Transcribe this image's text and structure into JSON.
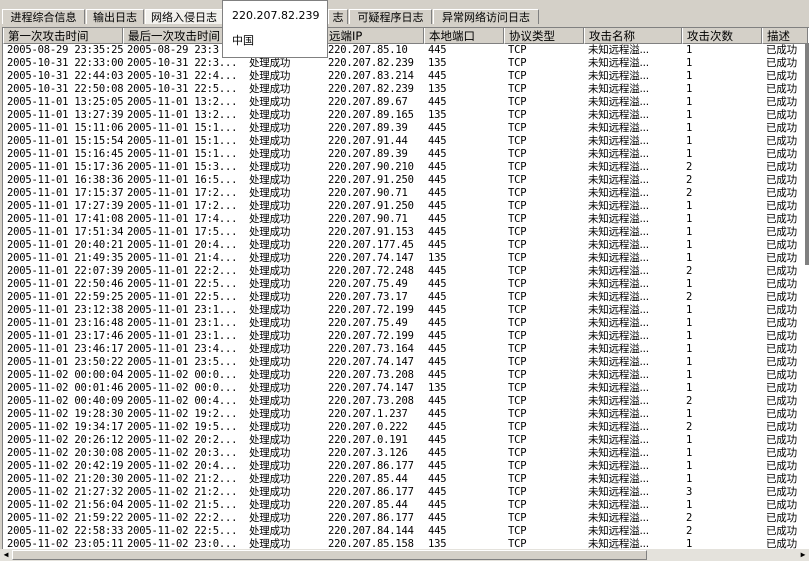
{
  "tabs": [
    {
      "label": "进程综合信息",
      "active": false
    },
    {
      "label": "输出日志",
      "active": false
    },
    {
      "label": "网络入侵日志",
      "active": true
    },
    {
      "label": "志",
      "active": false
    },
    {
      "label": "可疑程序日志",
      "active": false
    },
    {
      "label": "异常网络访问日志",
      "active": false
    }
  ],
  "tooltip": {
    "ip": "220.207.82.239",
    "country": "中国"
  },
  "columns": [
    "第一次攻击时间",
    "最后一次攻击时间",
    "",
    "远端IP",
    "本地端口",
    "协议类型",
    "攻击名称",
    "攻击次数",
    "描述"
  ],
  "rows": [
    [
      "2005-08-29 23:35:25",
      "2005-08-29 23:3",
      "",
      "220.207.85.10",
      "445",
      "TCP",
      "未知远程溢...",
      "1",
      "已成功"
    ],
    [
      "2005-10-31 22:33:00",
      "2005-10-31 22:3...",
      "处理成功",
      "220.207.82.239",
      "135",
      "TCP",
      "未知远程溢...",
      "1",
      "已成功"
    ],
    [
      "2005-10-31 22:44:03",
      "2005-10-31 22:4...",
      "处理成功",
      "220.207.83.214",
      "445",
      "TCP",
      "未知远程溢...",
      "1",
      "已成功"
    ],
    [
      "2005-10-31 22:50:08",
      "2005-10-31 22:5...",
      "处理成功",
      "220.207.82.239",
      "135",
      "TCP",
      "未知远程溢...",
      "1",
      "已成功"
    ],
    [
      "2005-11-01 13:25:05",
      "2005-11-01 13:2...",
      "处理成功",
      "220.207.89.67",
      "445",
      "TCP",
      "未知远程溢...",
      "1",
      "已成功"
    ],
    [
      "2005-11-01 13:27:39",
      "2005-11-01 13:2...",
      "处理成功",
      "220.207.89.165",
      "135",
      "TCP",
      "未知远程溢...",
      "1",
      "已成功"
    ],
    [
      "2005-11-01 15:11:06",
      "2005-11-01 15:1...",
      "处理成功",
      "220.207.89.39",
      "445",
      "TCP",
      "未知远程溢...",
      "1",
      "已成功"
    ],
    [
      "2005-11-01 15:15:54",
      "2005-11-01 15:1...",
      "处理成功",
      "220.207.91.44",
      "445",
      "TCP",
      "未知远程溢...",
      "1",
      "已成功"
    ],
    [
      "2005-11-01 15:16:45",
      "2005-11-01 15:1...",
      "处理成功",
      "220.207.89.39",
      "445",
      "TCP",
      "未知远程溢...",
      "1",
      "已成功"
    ],
    [
      "2005-11-01 15:17:36",
      "2005-11-01 15:3...",
      "处理成功",
      "220.207.90.210",
      "445",
      "TCP",
      "未知远程溢...",
      "2",
      "已成功"
    ],
    [
      "2005-11-01 16:38:36",
      "2005-11-01 16:5...",
      "处理成功",
      "220.207.91.250",
      "445",
      "TCP",
      "未知远程溢...",
      "2",
      "已成功"
    ],
    [
      "2005-11-01 17:15:37",
      "2005-11-01 17:2...",
      "处理成功",
      "220.207.90.71",
      "445",
      "TCP",
      "未知远程溢...",
      "2",
      "已成功"
    ],
    [
      "2005-11-01 17:27:39",
      "2005-11-01 17:2...",
      "处理成功",
      "220.207.91.250",
      "445",
      "TCP",
      "未知远程溢...",
      "1",
      "已成功"
    ],
    [
      "2005-11-01 17:41:08",
      "2005-11-01 17:4...",
      "处理成功",
      "220.207.90.71",
      "445",
      "TCP",
      "未知远程溢...",
      "1",
      "已成功"
    ],
    [
      "2005-11-01 17:51:34",
      "2005-11-01 17:5...",
      "处理成功",
      "220.207.91.153",
      "445",
      "TCP",
      "未知远程溢...",
      "1",
      "已成功"
    ],
    [
      "2005-11-01 20:40:21",
      "2005-11-01 20:4...",
      "处理成功",
      "220.207.177.45",
      "445",
      "TCP",
      "未知远程溢...",
      "1",
      "已成功"
    ],
    [
      "2005-11-01 21:49:35",
      "2005-11-01 21:4...",
      "处理成功",
      "220.207.74.147",
      "135",
      "TCP",
      "未知远程溢...",
      "1",
      "已成功"
    ],
    [
      "2005-11-01 22:07:39",
      "2005-11-01 22:2...",
      "处理成功",
      "220.207.72.248",
      "445",
      "TCP",
      "未知远程溢...",
      "2",
      "已成功"
    ],
    [
      "2005-11-01 22:50:46",
      "2005-11-01 22:5...",
      "处理成功",
      "220.207.75.49",
      "445",
      "TCP",
      "未知远程溢...",
      "1",
      "已成功"
    ],
    [
      "2005-11-01 22:59:25",
      "2005-11-01 22:5...",
      "处理成功",
      "220.207.73.17",
      "445",
      "TCP",
      "未知远程溢...",
      "2",
      "已成功"
    ],
    [
      "2005-11-01 23:12:38",
      "2005-11-01 23:1...",
      "处理成功",
      "220.207.72.199",
      "445",
      "TCP",
      "未知远程溢...",
      "1",
      "已成功"
    ],
    [
      "2005-11-01 23:16:48",
      "2005-11-01 23:1...",
      "处理成功",
      "220.207.75.49",
      "445",
      "TCP",
      "未知远程溢...",
      "1",
      "已成功"
    ],
    [
      "2005-11-01 23:17:46",
      "2005-11-01 23:1...",
      "处理成功",
      "220.207.72.199",
      "445",
      "TCP",
      "未知远程溢...",
      "1",
      "已成功"
    ],
    [
      "2005-11-01 23:46:17",
      "2005-11-01 23:4...",
      "处理成功",
      "220.207.73.164",
      "445",
      "TCP",
      "未知远程溢...",
      "1",
      "已成功"
    ],
    [
      "2005-11-01 23:50:22",
      "2005-11-01 23:5...",
      "处理成功",
      "220.207.74.147",
      "445",
      "TCP",
      "未知远程溢...",
      "1",
      "已成功"
    ],
    [
      "2005-11-02 00:00:04",
      "2005-11-02 00:0...",
      "处理成功",
      "220.207.73.208",
      "445",
      "TCP",
      "未知远程溢...",
      "1",
      "已成功"
    ],
    [
      "2005-11-02 00:01:46",
      "2005-11-02 00:0...",
      "处理成功",
      "220.207.74.147",
      "135",
      "TCP",
      "未知远程溢...",
      "1",
      "已成功"
    ],
    [
      "2005-11-02 00:40:09",
      "2005-11-02 00:4...",
      "处理成功",
      "220.207.73.208",
      "445",
      "TCP",
      "未知远程溢...",
      "2",
      "已成功"
    ],
    [
      "2005-11-02 19:28:30",
      "2005-11-02 19:2...",
      "处理成功",
      "220.207.1.237",
      "445",
      "TCP",
      "未知远程溢...",
      "1",
      "已成功"
    ],
    [
      "2005-11-02 19:34:17",
      "2005-11-02 19:5...",
      "处理成功",
      "220.207.0.222",
      "445",
      "TCP",
      "未知远程溢...",
      "2",
      "已成功"
    ],
    [
      "2005-11-02 20:26:12",
      "2005-11-02 20:2...",
      "处理成功",
      "220.207.0.191",
      "445",
      "TCP",
      "未知远程溢...",
      "1",
      "已成功"
    ],
    [
      "2005-11-02 20:30:08",
      "2005-11-02 20:3...",
      "处理成功",
      "220.207.3.126",
      "445",
      "TCP",
      "未知远程溢...",
      "1",
      "已成功"
    ],
    [
      "2005-11-02 20:42:19",
      "2005-11-02 20:4...",
      "处理成功",
      "220.207.86.177",
      "445",
      "TCP",
      "未知远程溢...",
      "1",
      "已成功"
    ],
    [
      "2005-11-02 21:20:30",
      "2005-11-02 21:2...",
      "处理成功",
      "220.207.85.44",
      "445",
      "TCP",
      "未知远程溢...",
      "1",
      "已成功"
    ],
    [
      "2005-11-02 21:27:32",
      "2005-11-02 21:2...",
      "处理成功",
      "220.207.86.177",
      "445",
      "TCP",
      "未知远程溢...",
      "3",
      "已成功"
    ],
    [
      "2005-11-02 21:56:04",
      "2005-11-02 21:5...",
      "处理成功",
      "220.207.85.44",
      "445",
      "TCP",
      "未知远程溢...",
      "1",
      "已成功"
    ],
    [
      "2005-11-02 21:59:22",
      "2005-11-02 22:2...",
      "处理成功",
      "220.207.86.177",
      "445",
      "TCP",
      "未知远程溢...",
      "2",
      "已成功"
    ],
    [
      "2005-11-02 22:58:33",
      "2005-11-02 22:5...",
      "处理成功",
      "220.207.84.144",
      "445",
      "TCP",
      "未知远程溢...",
      "2",
      "已成功"
    ],
    [
      "2005-11-02 23:05:11",
      "2005-11-02 23:0...",
      "处理成功",
      "220.207.85.158",
      "135",
      "TCP",
      "未知远程溢...",
      "1",
      "已成功"
    ]
  ]
}
